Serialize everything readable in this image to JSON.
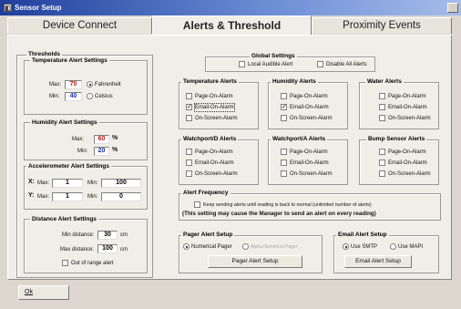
{
  "window": {
    "title": "Sensor Setup"
  },
  "tabs": [
    {
      "label": "Device Connect",
      "active": false
    },
    {
      "label": "Alerts & Threshold",
      "active": true
    },
    {
      "label": "Proximity Events",
      "active": false
    }
  ],
  "thresholds": {
    "title": "Thresholds",
    "temperature": {
      "title": "Temperature Alert Settings",
      "max_label": "Max:",
      "max_value": "70",
      "min_label": "Min:",
      "min_value": "40",
      "fahrenheit_label": "Fahrenheit",
      "celsius_label": "Celsius",
      "selected_unit": "Fahrenheit"
    },
    "humidity": {
      "title": "Humidity Alert Settings",
      "max_label": "Max:",
      "max_value": "60",
      "min_label": "Min:",
      "min_value": "20",
      "unit": "%"
    },
    "accelerometer": {
      "title": "Accelerometer Alert Settings",
      "x_label": "X:",
      "y_label": "Y:",
      "max_label": "Max:",
      "min_label": "Min:",
      "x_max": "1",
      "x_min": "100",
      "y_max": "1",
      "y_min": "0"
    },
    "distance": {
      "title": "Distance Alert Settings",
      "min_label": "Min distance:",
      "min_value": "30",
      "max_label": "Max distance:",
      "max_value": "100",
      "unit": "cm",
      "out_of_range_label": "Out of range alert"
    }
  },
  "global": {
    "title": "Global Settings",
    "audible_label": "Local Audible Alert",
    "disable_label": "Disable All Alerts"
  },
  "alert_groups": [
    {
      "title": "Temperature Alerts",
      "page": "Page-On-Alarm",
      "email": "Email-On-Alarm",
      "screen": "On-Screen-Alarm",
      "email_checked": true
    },
    {
      "title": "Humidity Alerts",
      "page": "Page-On-Alarm",
      "email": "Email-On-Alarm",
      "screen": "On-Screen-Alarm",
      "email_checked": true
    },
    {
      "title": "Water Alerts",
      "page": "Page-On-Alarm",
      "email": "Email-On-Alarm",
      "screen": "On-Screen-Alarm",
      "email_checked": false
    },
    {
      "title": "Watchport/D Alerts",
      "page": "Page-On-Alarm",
      "email": "Email-On-Alarm",
      "screen": "On-Screen-Alarm",
      "email_checked": false
    },
    {
      "title": "Watchport/A Alerts",
      "page": "Page-On-Alarm",
      "email": "Email-On-Alarm",
      "screen": "On-Screen-Alarm",
      "email_checked": false
    },
    {
      "title": "Bump Sensor Alerts",
      "page": "Page-On-Alarm",
      "email": "Email-On-Alarm",
      "screen": "On-Screen-Alarm",
      "email_checked": false
    }
  ],
  "frequency": {
    "title": "Alert Frequency",
    "keep_label": "Keep sending alerts until reading is back to normal (unlimited number of alerts)",
    "warning": "(This setting may cause the Manager to send an alert on every reading)"
  },
  "pager": {
    "title": "Pager Alert Setup",
    "numeric_label": "Numerical Pager",
    "alpha_label": "Alpha Numerical Pager",
    "button": "Pager Alert Setup"
  },
  "email": {
    "title": "Email Alert Setup",
    "smtp_label": "Use SMTP",
    "mapi_label": "Use MAPI",
    "button": "Email Alert Setup"
  },
  "ok_button": "Ok",
  "colors": {
    "titlebar": "#1f3f9d",
    "value_red": "#cc1111",
    "value_blue": "#1133aa"
  }
}
